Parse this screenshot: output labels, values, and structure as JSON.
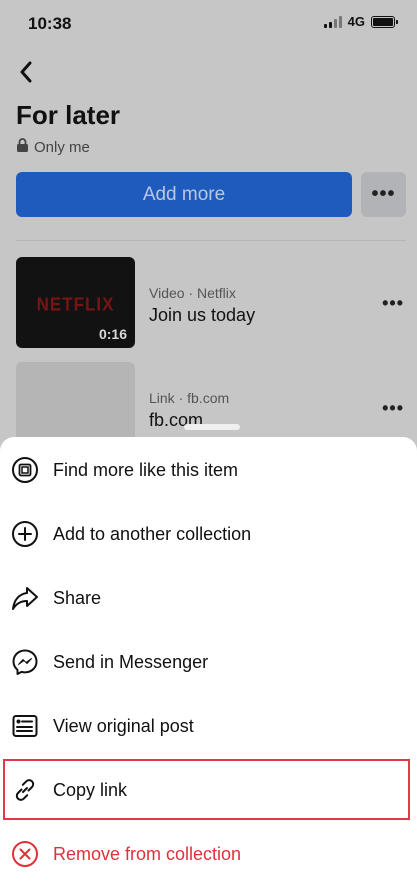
{
  "status_bar": {
    "time": "10:38",
    "network": "4G"
  },
  "header": {
    "title": "For later",
    "privacy": "Only me",
    "add_more_label": "Add more",
    "more_label": "•••"
  },
  "items": [
    {
      "meta": "Video · Netflix",
      "title": "Join us today",
      "thumb_text": "NETFLIX",
      "duration": "0:16",
      "more": "•••"
    },
    {
      "meta": "Link · fb.com",
      "title": "fb.com",
      "more": "•••"
    }
  ],
  "sheet": {
    "options": [
      {
        "label": "Find more like this item",
        "icon": "find-more-icon"
      },
      {
        "label": "Add to another collection",
        "icon": "add-circle-icon"
      },
      {
        "label": "Share",
        "icon": "share-icon"
      },
      {
        "label": "Send in Messenger",
        "icon": "messenger-icon"
      },
      {
        "label": "View original post",
        "icon": "post-icon"
      },
      {
        "label": "Copy link",
        "icon": "link-icon"
      },
      {
        "label": "Remove from collection",
        "icon": "remove-icon"
      }
    ]
  },
  "colors": {
    "primary": "#1f5bbd",
    "danger": "#e0303a",
    "highlight": "#e03a48"
  }
}
